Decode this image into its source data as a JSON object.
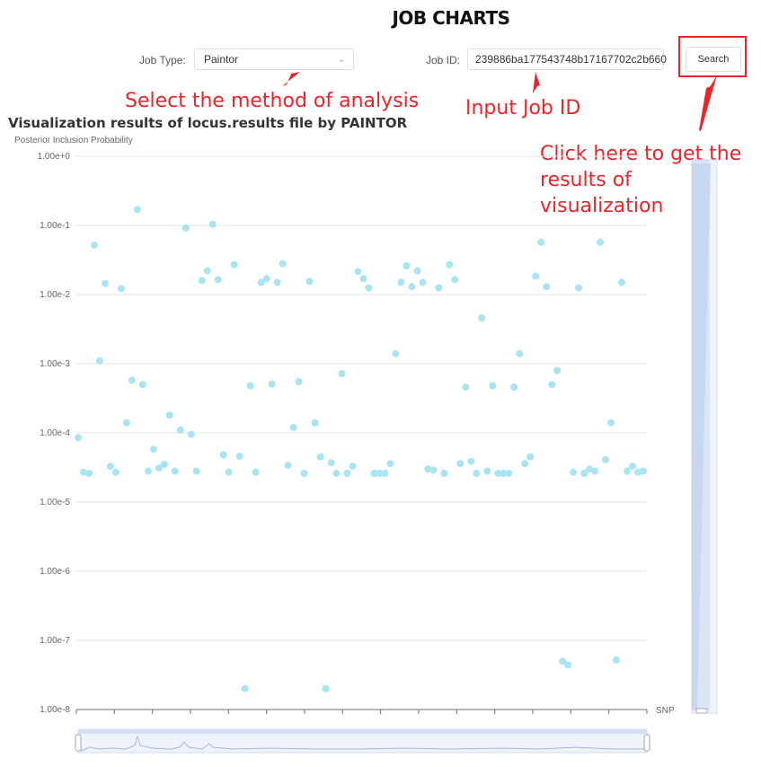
{
  "page": {
    "title": "JOB CHARTS"
  },
  "form": {
    "job_type_label": "Job Type:",
    "job_type_value": "Paintor",
    "job_id_label": "Job ID:",
    "job_id_value": "239886ba177543748b17167702c2b660",
    "search_label": "Search"
  },
  "annotations": {
    "method": "Select the method of analysis",
    "job_id": "Input Job ID",
    "search_line1": "Click here to get the",
    "search_line2": "results of visualization"
  },
  "colors": {
    "annotation": "#e8252a",
    "point": "#a8e4f2",
    "zoom": "#c5d3f2"
  },
  "chart_data": {
    "type": "scatter",
    "title": "Visualization results of locus.results file by PAINTOR",
    "ylabel": "Posterior Inclusion Probability",
    "xlabel": "SNP",
    "y_scale": "log",
    "ylim": [
      1e-08,
      1
    ],
    "y_tick_labels": [
      "1.00e+0",
      "1.00e-1",
      "1.00e-2",
      "1.00e-3",
      "1.00e-4",
      "1.00e-5",
      "1.00e-6",
      "1.00e-7",
      "1.00e-8"
    ],
    "grid": true,
    "values": [
      8.5e-05,
      2.7e-05,
      2.6e-05,
      0.052,
      0.0011,
      0.0145,
      3.3e-05,
      2.7e-05,
      0.0122,
      0.00014,
      0.00058,
      0.17,
      0.0005,
      2.8e-05,
      5.8e-05,
      3.1e-05,
      3.5e-05,
      0.00018,
      2.8e-05,
      0.00011,
      0.092,
      9.5e-05,
      2.8e-05,
      0.016,
      0.022,
      0.104,
      0.0165,
      4.8e-05,
      2.7e-05,
      0.027,
      4.6e-05,
      2e-08,
      0.00048,
      2.7e-05,
      0.015,
      0.017,
      0.00051,
      0.015,
      0.028,
      3.4e-05,
      0.00012,
      0.00055,
      2.6e-05,
      0.0155,
      0.00014,
      4.5e-05,
      2e-08,
      3.7e-05,
      2.6e-05,
      0.00072,
      2.6e-05,
      3.3e-05,
      0.0215,
      0.017,
      0.0125,
      2.6e-05,
      2.6e-05,
      2.6e-05,
      3.6e-05,
      0.0014,
      0.015,
      0.026,
      0.013,
      0.022,
      0.015,
      3e-05,
      2.9e-05,
      0.0125,
      2.6e-05,
      0.027,
      0.0165,
      3.6e-05,
      0.00046,
      3.9e-05,
      2.6e-05,
      0.0046,
      2.8e-05,
      0.00048,
      2.6e-05,
      2.6e-05,
      2.6e-05,
      0.00046,
      0.0014,
      3.6e-05,
      4.5e-05,
      0.0185,
      0.057,
      0.013,
      0.0005,
      0.0008,
      5e-08,
      4.4e-08,
      2.7e-05,
      0.0125,
      2.6e-05,
      3e-05,
      2.8e-05,
      0.057,
      4.1e-05,
      0.00014,
      5.2e-08,
      0.015,
      2.8e-05,
      3.3e-05,
      2.7e-05,
      2.8e-05
    ],
    "x_pixels_hint": "points evenly spaced along SNP axis"
  }
}
